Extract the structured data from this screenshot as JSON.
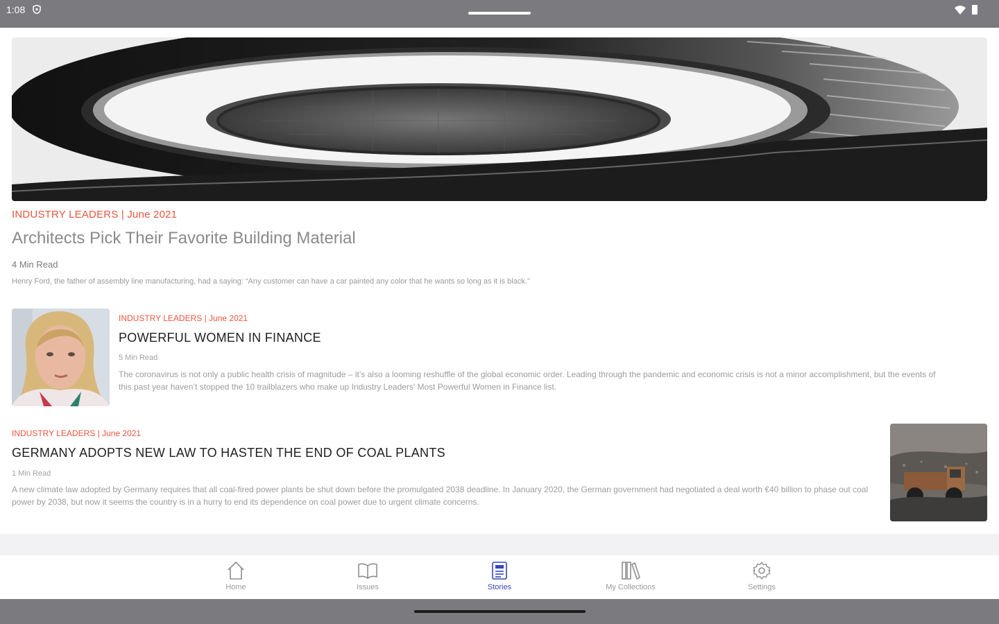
{
  "status_bar": {
    "time": "1:08"
  },
  "featured": {
    "category_date": "INDUSTRY LEADERS | June 2021",
    "title": "Architects Pick Their Favorite Building Material",
    "read_time": "4 Min Read",
    "excerpt": "Henry Ford, the father of assembly line manufacturing, had a saying: “Any customer can have a car painted any color that he wants so long as it is black.”"
  },
  "stories": [
    {
      "category_date": "INDUSTRY LEADERS | June 2021",
      "title": "POWERFUL WOMEN IN FINANCE",
      "read_time": "5 Min Read",
      "excerpt": "The coronavirus is not only a public health crisis of magnitude – it’s also a looming reshuffle of the global economic order. Leading through the pandemic and economic crisis is not a minor accomplishment, but the events of this past year haven’t stopped the 10 trailblazers who make up Industry Leaders’ Most Powerful Women in Finance list."
    },
    {
      "category_date": "INDUSTRY LEADERS | June 2021",
      "title": "GERMANY ADOPTS NEW LAW TO HASTEN THE END OF COAL PLANTS",
      "read_time": "1 Min Read",
      "excerpt": "A new climate law adopted by Germany requires that all coal-fired power plants be shut down before the promulgated 2038 deadline. In January 2020, the German government had negotiated a deal worth €40 billion to phase out coal power by 2038, but now it seems the country is in a hurry to end its dependence on coal power due to urgent climate concerns."
    }
  ],
  "tabs": [
    {
      "label": "Home",
      "icon": "home-icon"
    },
    {
      "label": "Issues",
      "icon": "book-icon"
    },
    {
      "label": "Stories",
      "icon": "document-icon"
    },
    {
      "label": "My Collections",
      "icon": "library-icon"
    },
    {
      "label": "Settings",
      "icon": "gear-icon"
    }
  ],
  "active_tab": "Stories",
  "colors": {
    "accent": "#e8553e",
    "active_tab": "#3546b8",
    "system_bar": "#7b7b7f"
  }
}
